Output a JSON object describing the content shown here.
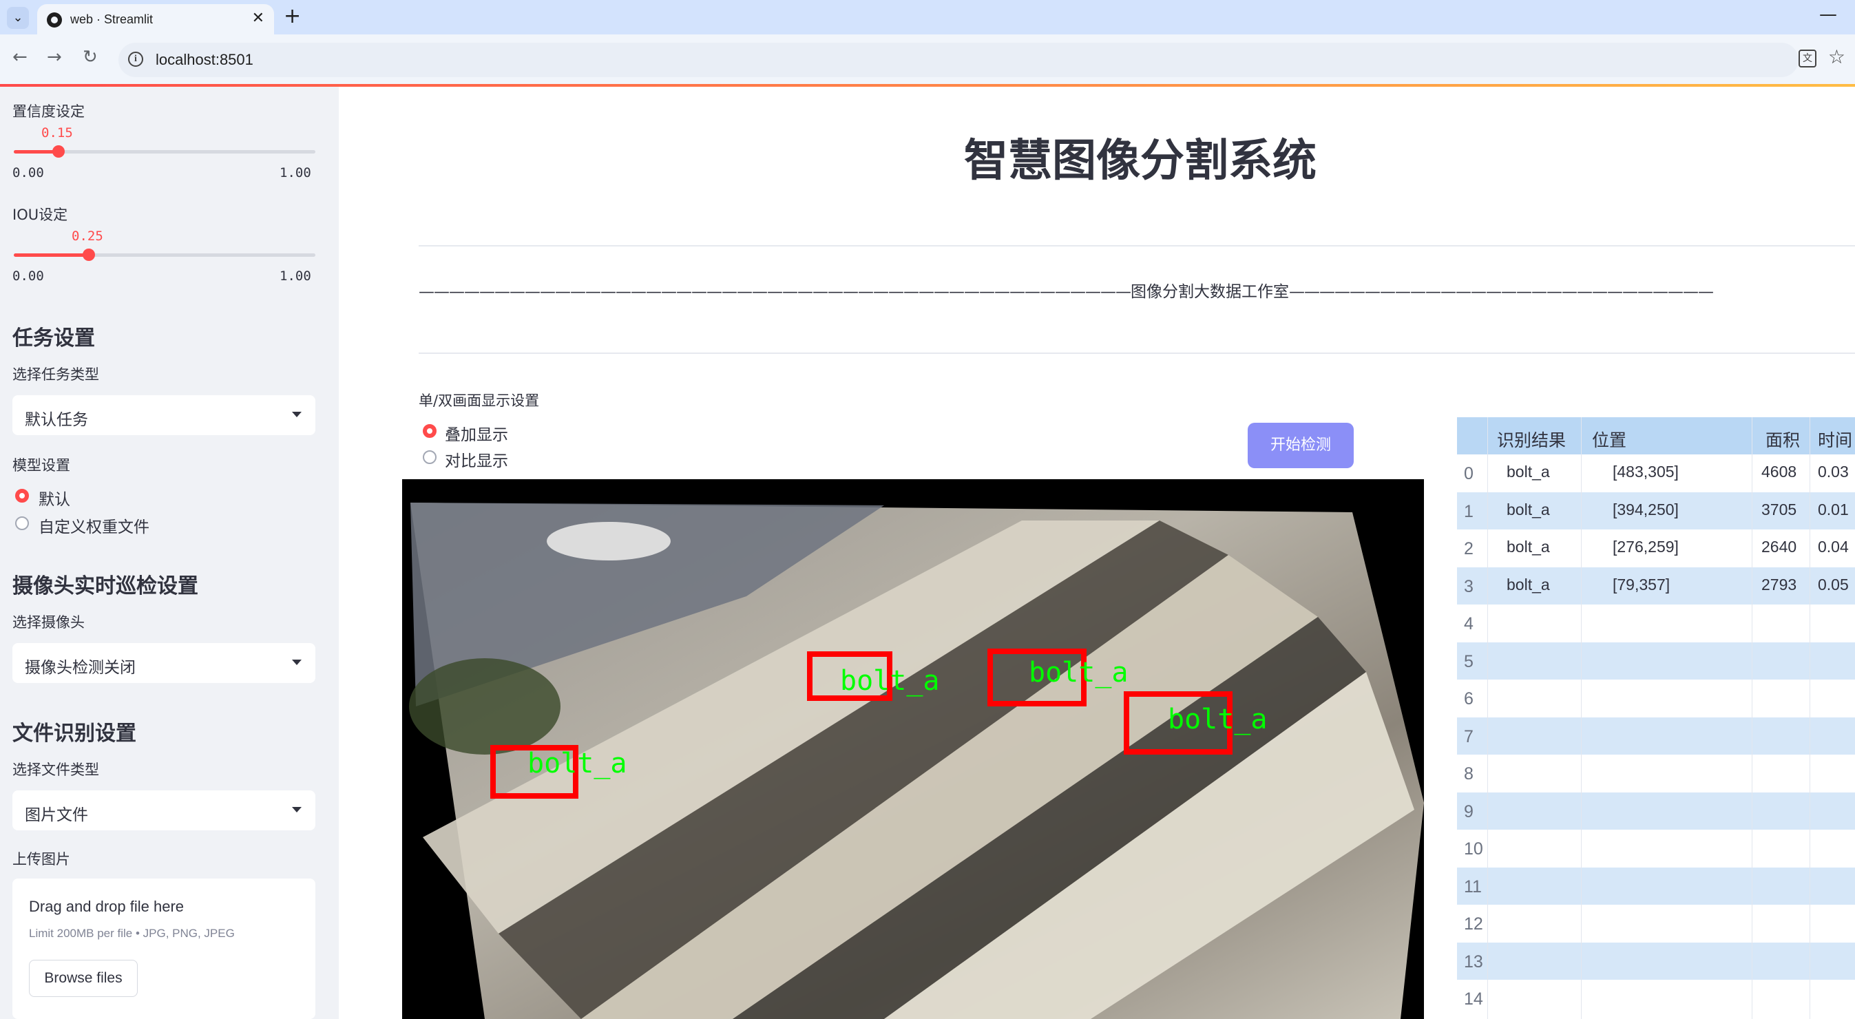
{
  "browser": {
    "tab_title": "web · Streamlit",
    "url": "localhost:8501"
  },
  "sidebar": {
    "confidence": {
      "label": "置信度设定",
      "value": "0.15",
      "value_fraction": 0.15,
      "min": "0.00",
      "max": "1.00"
    },
    "iou": {
      "label": "IOU设定",
      "value": "0.25",
      "value_fraction": 0.25,
      "min": "0.00",
      "max": "1.00"
    },
    "task_section": {
      "heading": "任务设置",
      "select_label": "选择任务类型",
      "select_value": "默认任务"
    },
    "model_section": {
      "label": "模型设置",
      "options": [
        "默认",
        "自定义权重文件"
      ],
      "selected": 0
    },
    "camera_section": {
      "heading": "摄像头实时巡检设置",
      "select_label": "选择摄像头",
      "select_value": "摄像头检测关闭"
    },
    "file_section": {
      "heading": "文件识别设置",
      "select_label": "选择文件类型",
      "select_value": "图片文件"
    },
    "upload": {
      "label": "上传图片",
      "title": "Drag and drop file here",
      "limit": "Limit 200MB per file • JPG, PNG, JPEG",
      "button": "Browse files"
    }
  },
  "main": {
    "title": "智慧图像分割系统",
    "studio_name": "图像分割大数据工作室",
    "display": {
      "label": "单/双画面显示设置",
      "options": [
        "叠加显示",
        "对比显示"
      ],
      "selected": 0
    },
    "run_button": "开始检测",
    "detections": [
      "bolt_a",
      "bolt_a",
      "bolt_a",
      "bolt_a"
    ]
  },
  "table": {
    "headers": [
      "识别结果",
      "位置",
      "面积",
      "时间"
    ],
    "rows": [
      {
        "idx": "0",
        "label": "bolt_a",
        "pos": "[483,305]",
        "area": "4608",
        "time": "0.03"
      },
      {
        "idx": "1",
        "label": "bolt_a",
        "pos": "[394,250]",
        "area": "3705",
        "time": "0.01"
      },
      {
        "idx": "2",
        "label": "bolt_a",
        "pos": "[276,259]",
        "area": "2640",
        "time": "0.04"
      },
      {
        "idx": "3",
        "label": "bolt_a",
        "pos": "[79,357]",
        "area": "2793",
        "time": "0.05"
      },
      {
        "idx": "4"
      },
      {
        "idx": "5"
      },
      {
        "idx": "6"
      },
      {
        "idx": "7"
      },
      {
        "idx": "8"
      },
      {
        "idx": "9"
      },
      {
        "idx": "10"
      },
      {
        "idx": "11"
      },
      {
        "idx": "12"
      },
      {
        "idx": "13"
      },
      {
        "idx": "14"
      }
    ]
  },
  "colors": {
    "accent": "#ff4b4b",
    "button": "#8b8ff7",
    "sidebar_bg": "#f0f2f6",
    "table_header": "#b9d7f4",
    "detection_box": "#ff0000",
    "detection_text": "#00ff00"
  }
}
